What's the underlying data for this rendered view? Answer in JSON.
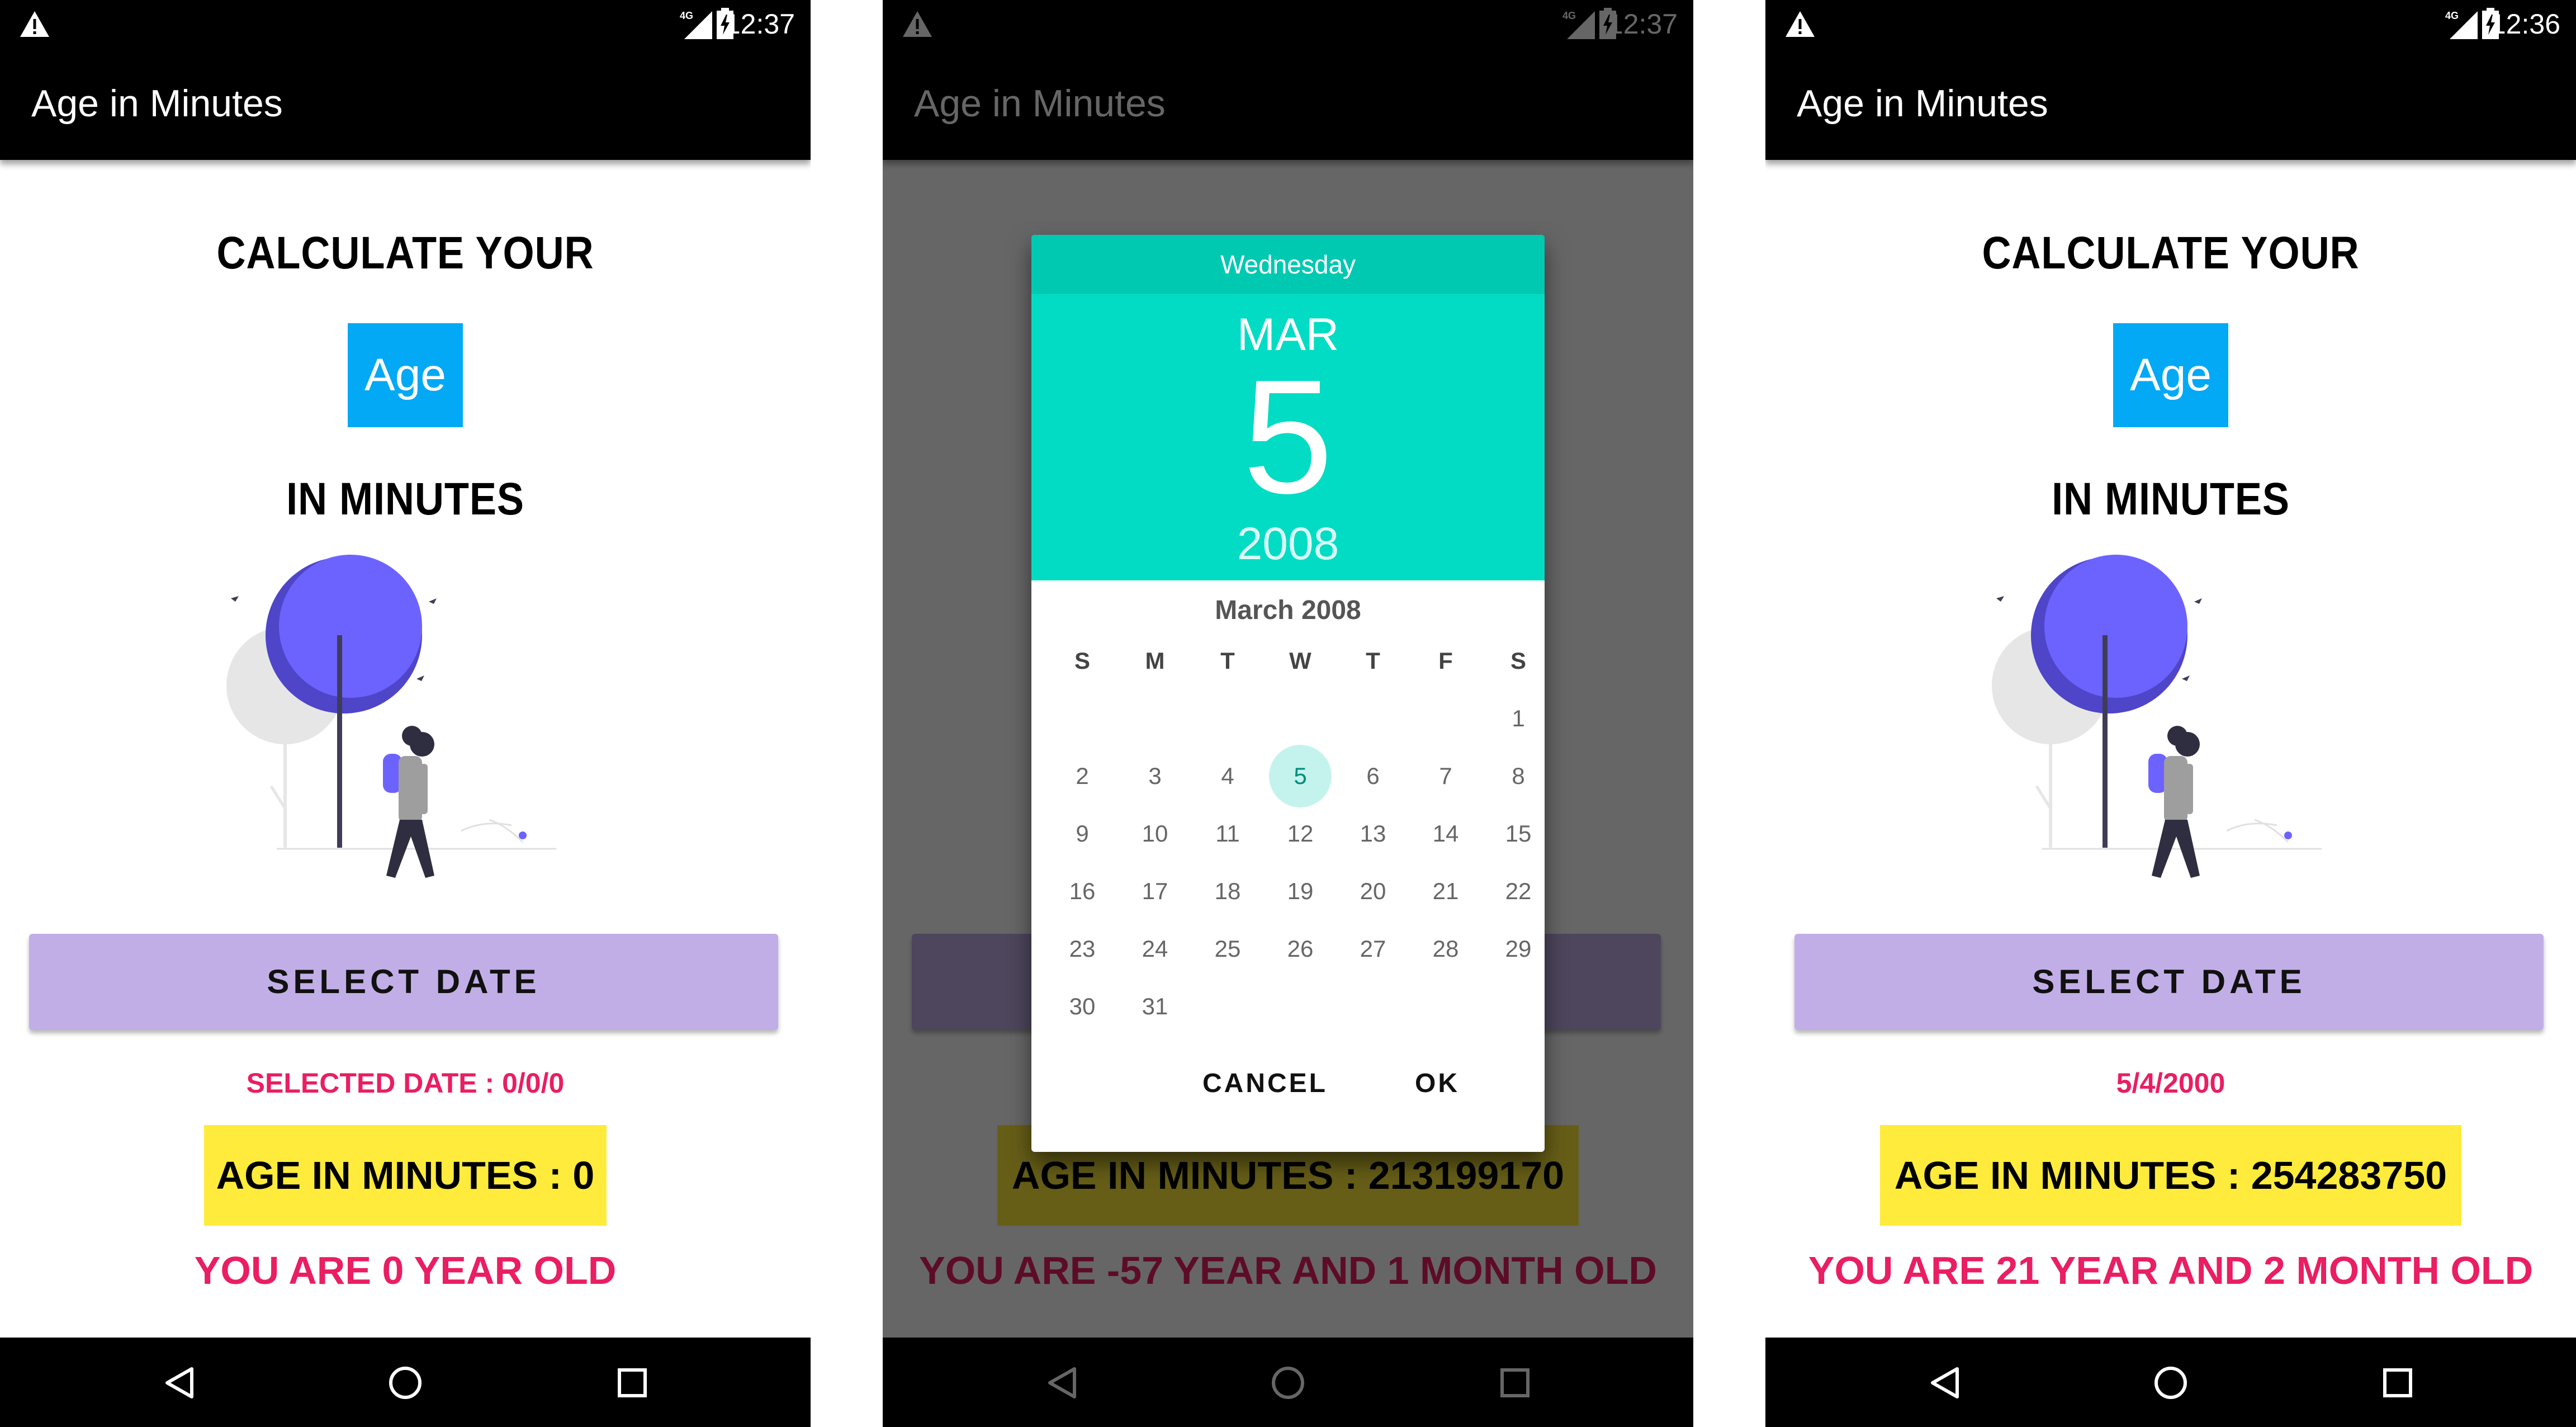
{
  "colors": {
    "bar": "#000000",
    "age_box": "#03a9f4",
    "button": "#c1aee6",
    "highlight": "#ffeb3b",
    "accent_text": "#e91e63",
    "dialog_header": "#03dcc4",
    "dialog_day_strip": "#00c9b2",
    "scrim": "rgba(0,0,0,0.6)"
  },
  "screens": [
    {
      "status": {
        "time": "12:37",
        "icons": [
          "warning-icon",
          "signal-4g-icon",
          "battery-charging-icon"
        ]
      },
      "app_title": "Age in Minutes",
      "heading_top": "CALCULATE YOUR",
      "age_word": "Age",
      "heading_bottom": "IN MINUTES",
      "illustration": "woman-walking-under-tree-illustration",
      "button_label": "SELECT DATE",
      "selected_text": "SELECTED DATE : 0/0/0",
      "age_minutes": "AGE IN MINUTES : 0",
      "you_are": "YOU ARE 0 YEAR OLD",
      "nav": [
        "back-icon",
        "home-icon",
        "recents-icon"
      ]
    },
    {
      "status": {
        "time": "12:37",
        "icons": [
          "warning-icon",
          "signal-4g-icon",
          "battery-charging-icon"
        ]
      },
      "app_title": "Age in Minutes",
      "heading_top": "CALCULATE YOUR",
      "age_word": "Age",
      "heading_bottom": "IN MINUTES",
      "illustration": "woman-walking-under-tree-illustration",
      "button_label": "SELECT DATE",
      "selected_text": "",
      "age_minutes": "AGE IN MINUTES : 213199170",
      "you_are": "YOU ARE -57 YEAR AND 1 MONTH OLD",
      "nav": [
        "back-icon",
        "home-icon",
        "recents-icon"
      ],
      "dialog": {
        "weekday": "Wednesday",
        "month": "MAR",
        "day": "5",
        "year": "2008",
        "calendar_title": "March 2008",
        "weekdays": [
          "S",
          "M",
          "T",
          "W",
          "T",
          "F",
          "S"
        ],
        "weeks": [
          [
            "",
            "",
            "",
            "",
            "",
            "",
            "1"
          ],
          [
            "2",
            "3",
            "4",
            "5",
            "6",
            "7",
            "8"
          ],
          [
            "9",
            "10",
            "11",
            "12",
            "13",
            "14",
            "15"
          ],
          [
            "16",
            "17",
            "18",
            "19",
            "20",
            "21",
            "22"
          ],
          [
            "23",
            "24",
            "25",
            "26",
            "27",
            "28",
            "29"
          ],
          [
            "30",
            "31",
            "",
            "",
            "",
            "",
            ""
          ]
        ],
        "selected_day": "5",
        "cancel_label": "CANCEL",
        "ok_label": "OK"
      }
    },
    {
      "status": {
        "time": "12:36",
        "icons": [
          "warning-icon",
          "signal-4g-icon",
          "battery-charging-icon"
        ]
      },
      "app_title": "Age in Minutes",
      "heading_top": "CALCULATE YOUR",
      "age_word": "Age",
      "heading_bottom": "IN MINUTES",
      "illustration": "woman-walking-under-tree-illustration",
      "button_label": "SELECT DATE",
      "selected_text": "5/4/2000",
      "age_minutes": "AGE IN MINUTES : 254283750",
      "you_are": "YOU ARE 21 YEAR AND 2 MONTH OLD",
      "nav": [
        "back-icon",
        "home-icon",
        "recents-icon"
      ]
    }
  ]
}
